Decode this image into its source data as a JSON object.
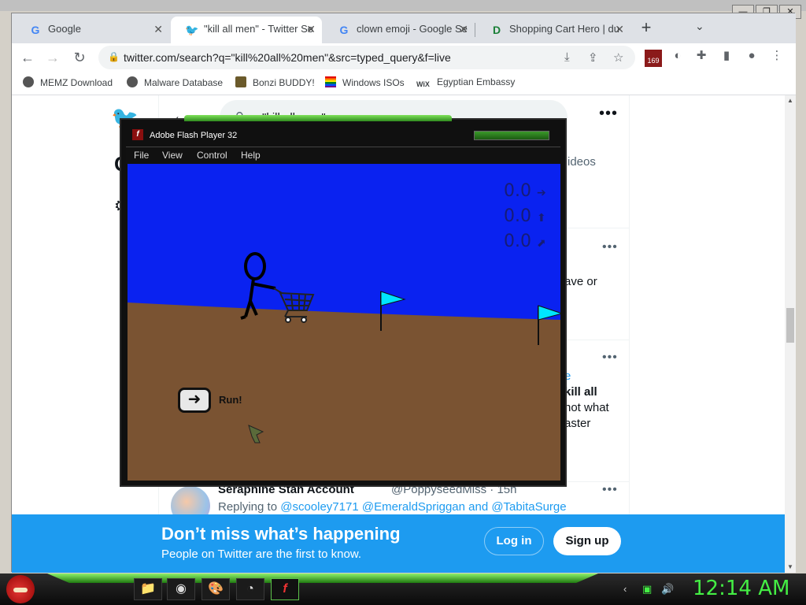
{
  "browser": {
    "tabs": [
      {
        "title": "Google",
        "icon": "google-icon"
      },
      {
        "title": "\"kill all men\" - Twitter Se",
        "icon": "twitter-icon"
      },
      {
        "title": "clown emoji - Google Se",
        "icon": "google-icon"
      },
      {
        "title": "Shopping Cart Hero | du",
        "icon": "d-icon"
      }
    ],
    "url": "twitter.com/search?q=\"kill%20all%20men\"&src=typed_query&f=live",
    "extension_badge": "169",
    "bookmarks": [
      {
        "label": "MEMZ Download"
      },
      {
        "label": "Malware Database"
      },
      {
        "label": "Bonzi BUDDY!"
      },
      {
        "label": "Windows ISOs"
      },
      {
        "label": "Egyptian Embassy"
      }
    ]
  },
  "twitter": {
    "search_query": "\"kill all men\"",
    "tab_videos": "ideos",
    "fragments": {
      "f1": "ave or",
      "f2": "e",
      "f3": "kill all",
      "f4": "not what",
      "f5": "aster"
    },
    "reply": {
      "name": "Seraphine Stan Account",
      "handle": "@PoppyseedMiss · 15h",
      "replying_to": "Replying to",
      "mentions": "@scooley7171 @EmeraldSpriggan and @TabitaSurge"
    },
    "banner": {
      "title": "Don’t miss what’s happening",
      "subtitle": "People on Twitter are the first to know.",
      "login": "Log in",
      "signup": "Sign up"
    }
  },
  "flash": {
    "title": "Adobe Flash Player 32",
    "menu": [
      "File",
      "View",
      "Control",
      "Help"
    ],
    "scores": [
      "0.0",
      "0.0",
      "0.0"
    ],
    "run_label": "Run!"
  },
  "taskbar": {
    "clock": "12:14 AM"
  },
  "colors": {
    "sky": "#0a22f0",
    "ground": "#7a5332",
    "flag": "#00e5ff",
    "twitter_blue": "#1d9bf0",
    "clock_green": "#44ee44"
  }
}
